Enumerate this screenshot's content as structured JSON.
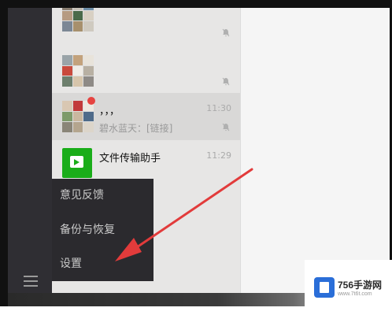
{
  "chats": [
    {
      "name": "",
      "preview": "",
      "time": "",
      "muted": true
    },
    {
      "name": "",
      "preview": "",
      "time": "",
      "muted": true
    },
    {
      "name": "，，，",
      "preview": "碧水蓝天：[链接]",
      "time": "11:30",
      "muted": true,
      "unread_dot": true
    },
    {
      "name": "文件传输助手",
      "preview": "",
      "time": "11:29",
      "muted": false
    }
  ],
  "menu": {
    "feedback": "意见反馈",
    "backup": "备份与恢复",
    "settings": "设置"
  },
  "watermark": {
    "brand": "756手游网",
    "url": "www.7t6t.com"
  },
  "colors": {
    "sidebar": "#2f2e33",
    "menu_bg": "#2b2a2e",
    "arrow": "#e23b3b",
    "file_helper": "#1aad19",
    "unread_dot": "#e64340"
  }
}
